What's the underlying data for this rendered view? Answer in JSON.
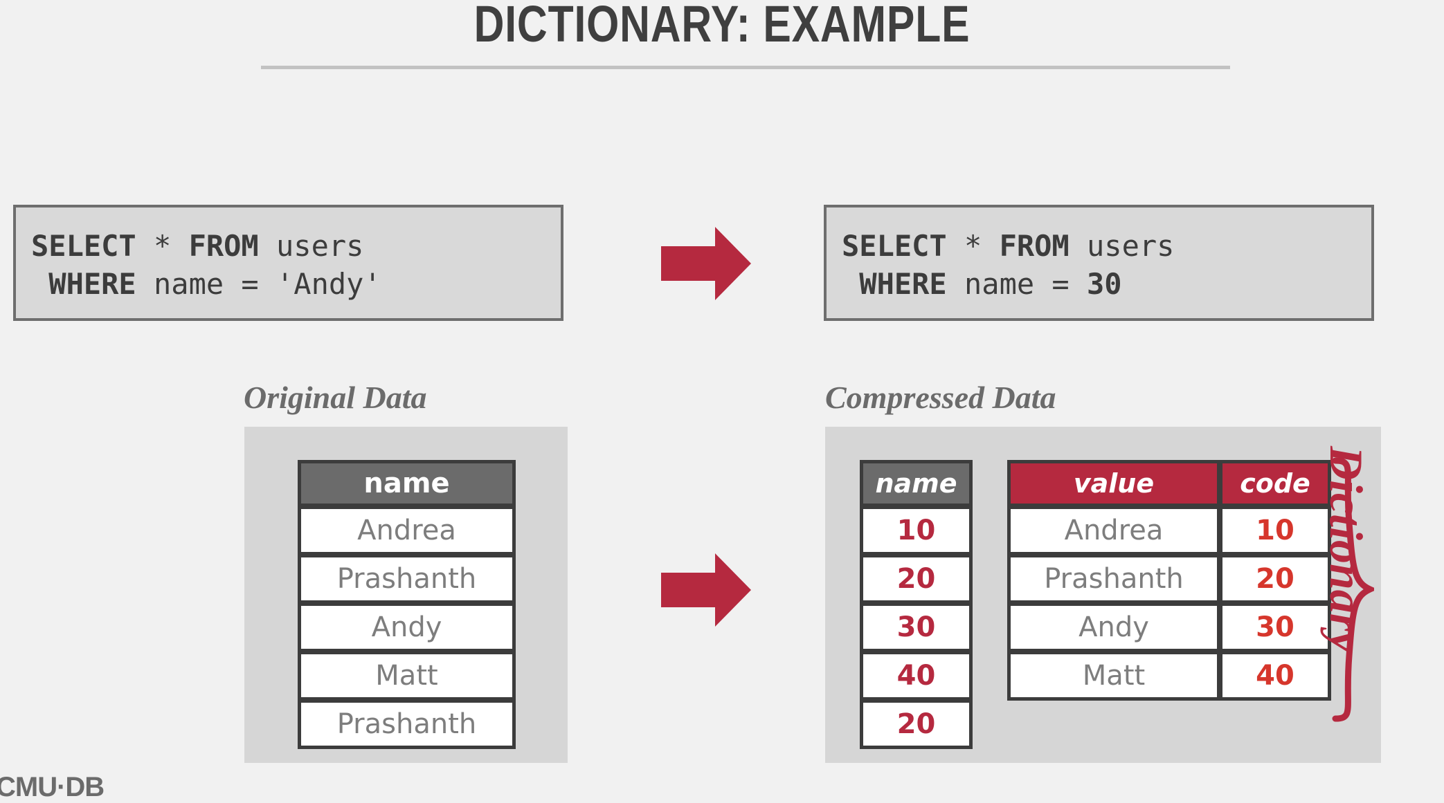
{
  "slide": {
    "title": "DICTIONARY: EXAMPLE",
    "footer_logo": "CMU·DB"
  },
  "colors": {
    "background": "#f1f1f1",
    "panel_gray": "#d6d6d6",
    "code_box_bg": "#d9d9d9",
    "code_box_border": "#6e6e6e",
    "header_gray": "#6b6b6b",
    "accent_crimson": "#b5293f",
    "accent_red": "#d6362c",
    "text_dark": "#3c3c3c",
    "text_gray": "#7d7d7d",
    "rule_gray": "#c2c2c2"
  },
  "sql": {
    "left": {
      "line1_keyword1": "SELECT",
      "line1_star": " * ",
      "line1_keyword2": "FROM",
      "line1_table": " users",
      "line2_keyword": " WHERE",
      "line2_rest": " name = 'Andy'"
    },
    "right": {
      "line1_keyword1": "SELECT",
      "line1_star": " * ",
      "line1_keyword2": "FROM",
      "line1_table": " users",
      "line2_keyword": " WHERE",
      "line2_col": " name = ",
      "line2_value": "30"
    }
  },
  "captions": {
    "original": "Original Data",
    "compressed": "Compressed Data",
    "dictionary": "Dictionary"
  },
  "icons": {
    "arrow_top": "right-arrow-icon",
    "arrow_middle": "right-arrow-icon",
    "brace": "curly-brace-icon"
  },
  "tables": {
    "original": {
      "header": "name",
      "rows": [
        "Andrea",
        "Prashanth",
        "Andy",
        "Matt",
        "Prashanth"
      ]
    },
    "compressed_name": {
      "header": "name",
      "rows": [
        "10",
        "20",
        "30",
        "40",
        "20"
      ]
    },
    "dictionary": {
      "headers": [
        "value",
        "code"
      ],
      "rows": [
        [
          "Andrea",
          "10"
        ],
        [
          "Prashanth",
          "20"
        ],
        [
          "Andy",
          "30"
        ],
        [
          "Matt",
          "40"
        ]
      ]
    }
  }
}
